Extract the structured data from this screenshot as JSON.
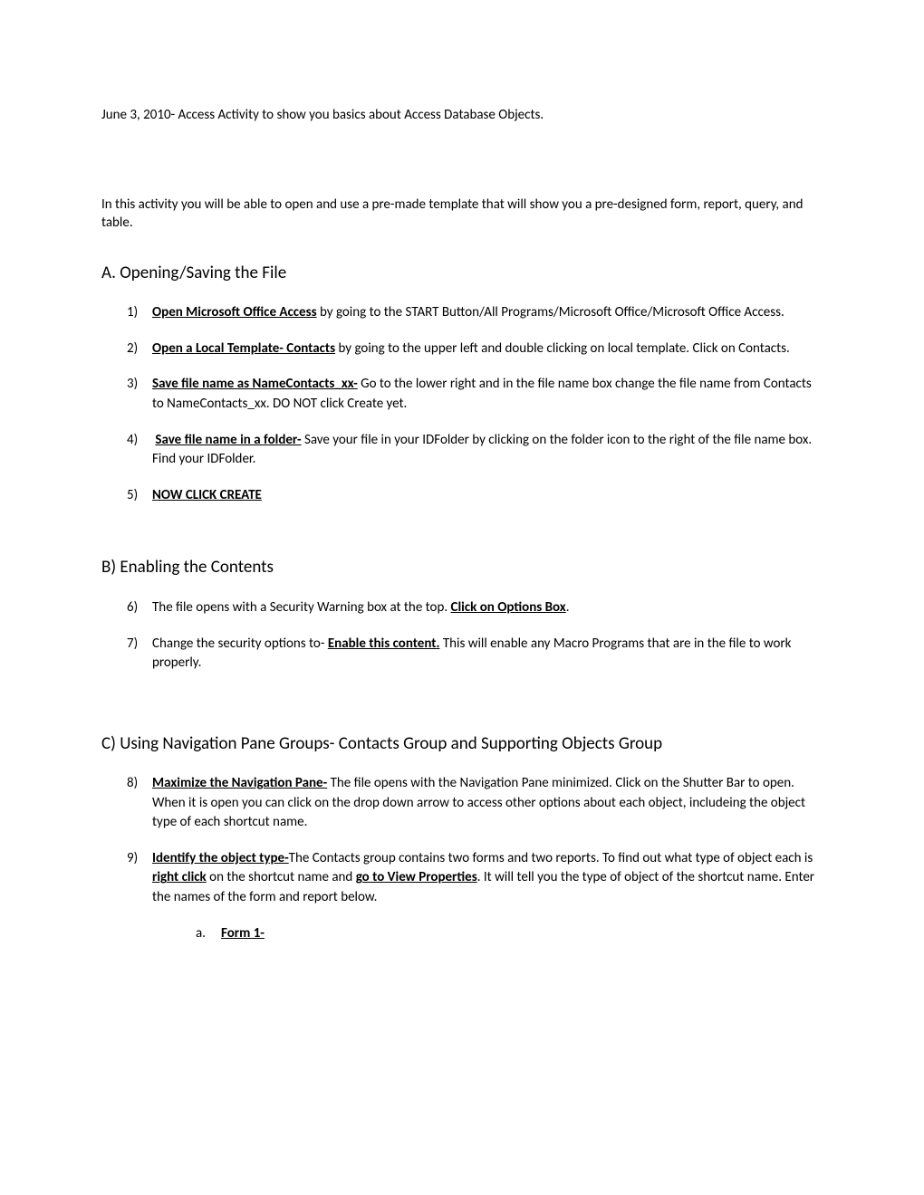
{
  "header": {
    "date_line": "June 3, 2010- Access Activity to show you basics about Access Database Objects."
  },
  "intro": "In this activity you will be able to open and use a pre-made template that will show you a pre-designed form, report, query, and table.",
  "sections": {
    "a": {
      "heading": "A.  Opening/Saving the File",
      "items": {
        "1": {
          "num": "1)",
          "lead": "Open Microsoft Office Access",
          "rest": " by going to the START Button/All Programs/Microsoft Office/Microsoft Office Access."
        },
        "2": {
          "num": "2)",
          "lead": "Open a Local Template- Contacts",
          "rest": " by going to the upper left and double clicking on local template. Click on Contacts."
        },
        "3": {
          "num": "3)",
          "lead": "Save file name as NameContacts_xx-",
          "rest": " Go to the lower right and in the file name box change the file name from Contacts to NameContacts_xx. DO NOT  click Create yet."
        },
        "4": {
          "num": "4)",
          "lead": "Save file name in a folder-",
          "rest": " Save your file in your IDFolder by clicking on the folder icon to the right of the file name box. Find your IDFolder."
        },
        "5": {
          "num": "5)",
          "lead": "NOW CLICK CREATE",
          "rest": ""
        }
      }
    },
    "b": {
      "heading": "B)  Enabling the Contents",
      "items": {
        "6": {
          "num": "6)",
          "pre": "The file opens with a Security Warning box at the top. ",
          "lead": "Click on Options Box",
          "rest": "."
        },
        "7": {
          "num": "7)",
          "pre": "Change the security options to- ",
          "lead": "Enable this content.",
          "rest": " This will enable any Macro Programs that are in the file to work properly."
        }
      }
    },
    "c": {
      "heading": "C)  Using Navigation Pane Groups- Contacts Group and Supporting Objects Group",
      "items": {
        "8": {
          "num": "8)",
          "lead": "Maximize the Navigation Pane-",
          "rest": " The file opens with the Navigation Pane minimized. Click on the Shutter Bar to open. When it is open you can click on the drop down arrow to access other options about each object, includeing the object type of each shortcut name."
        },
        "9": {
          "num": "9)",
          "lead": "Identify the object type-",
          "mid1": "The Contacts group contains two forms and two reports. To find out what type of object each is ",
          "bold2": "right click",
          "mid2": " on the shortcut name and ",
          "bold3": "go to View Properties",
          "mid3": ". It will tell you the type of object of the shortcut name. Enter the names of the form and report below.",
          "sub": {
            "marker": "a.",
            "text": "Form 1-"
          }
        }
      }
    }
  }
}
